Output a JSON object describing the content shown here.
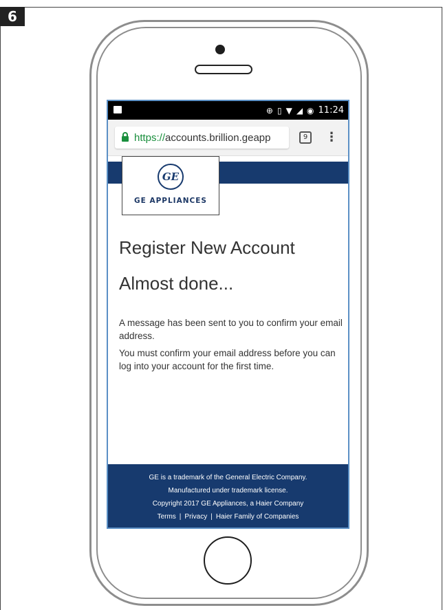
{
  "step_number": "6",
  "status_bar": {
    "time": "11:24",
    "tab_count": "9"
  },
  "browser": {
    "url_scheme": "https://",
    "url_rest": "accounts.brillion.geapp"
  },
  "logo": {
    "monogram": "GE",
    "brand": "GE APPLIANCES"
  },
  "page": {
    "title": "Register New Account",
    "subtitle": "Almost done...",
    "message1": "A message has been sent to you to confirm your email address.",
    "message2": "You must confirm your email address before you can log into your account for the first time."
  },
  "footer": {
    "line1": "GE is a trademark of the General Electric Company.",
    "line2": "Manufactured under trademark license.",
    "line3": "Copyright   2017 GE Appliances, a Haier Company",
    "links": [
      "Terms",
      "Privacy",
      "Haier Family of Companies"
    ],
    "separator": "|"
  },
  "colors": {
    "brand_navy": "#173a6e",
    "lock_green": "#1a8f3d",
    "screen_border": "#5a8fc5"
  }
}
